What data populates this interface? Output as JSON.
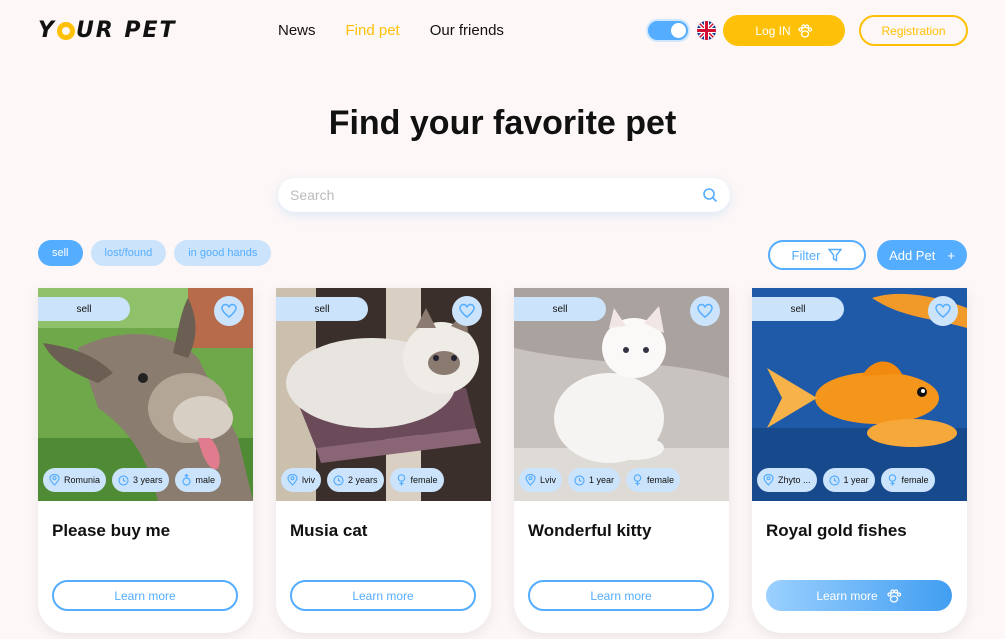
{
  "header": {
    "logo": {
      "part1": "Y",
      "part2": "UR PET"
    },
    "nav": [
      {
        "label": "News",
        "active": false
      },
      {
        "label": "Find pet",
        "active": true
      },
      {
        "label": "Our friends",
        "active": false
      }
    ],
    "login_label": "Log IN",
    "registration_label": "Registration"
  },
  "page_title": "Find your favorite pet",
  "search": {
    "placeholder": "Search",
    "value": ""
  },
  "filters": {
    "chips": [
      {
        "label": "sell",
        "active": true
      },
      {
        "label": "lost/found",
        "active": false
      },
      {
        "label": "in good hands",
        "active": false
      }
    ],
    "filter_label": "Filter",
    "add_pet_label": "Add Pet",
    "add_pet_sign": "+"
  },
  "cards": [
    {
      "category": "sell",
      "name": "Please buy me",
      "location": "Romunia",
      "age": "3 years",
      "sex": "male",
      "button": "Learn more"
    },
    {
      "category": "sell",
      "name": "Musia cat",
      "location": "lviv",
      "age": "2 years",
      "sex": "female",
      "button": "Learn more"
    },
    {
      "category": "sell",
      "name": "Wonderful kitty",
      "location": "Lviv",
      "age": "1 year",
      "sex": "female",
      "button": "Learn more"
    },
    {
      "category": "sell",
      "name": "Royal gold fishes",
      "location": "Zhyto ...",
      "age": "1 year",
      "sex": "female",
      "button": "Learn more"
    }
  ],
  "colors": {
    "accent_blue": "#54adff",
    "accent_yellow": "#ffc107",
    "chip_bg": "#cce4fb",
    "background": "#fdf7f7"
  },
  "icons": [
    "paw-icon",
    "search-icon",
    "filter-icon",
    "heart-icon",
    "location-icon",
    "clock-icon",
    "male-icon",
    "female-icon",
    "theme-toggle",
    "uk-flag-icon"
  ]
}
